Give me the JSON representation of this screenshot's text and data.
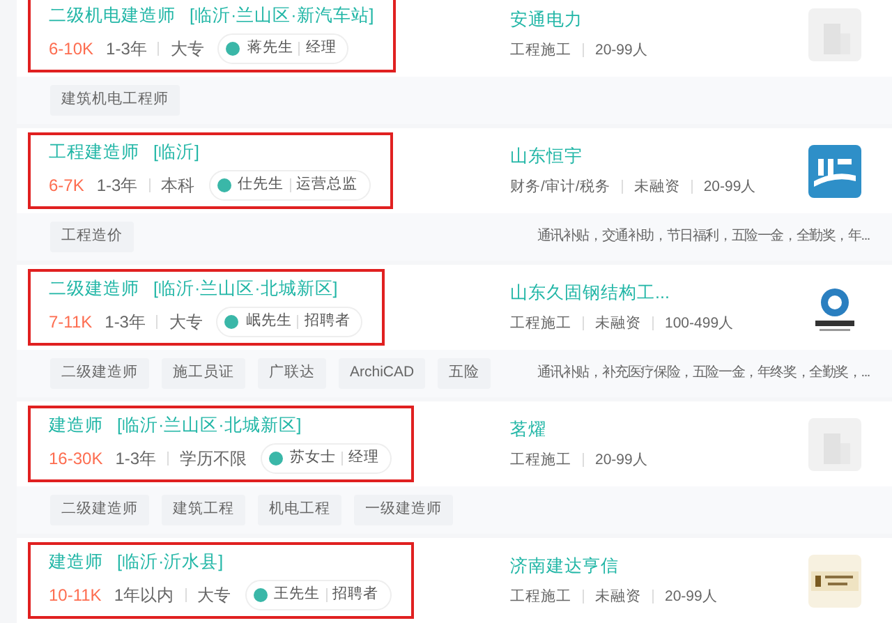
{
  "jobs": [
    {
      "title": "二级机电建造师",
      "location": "[临沂·兰山区·新汽车站]",
      "salary": "6-10K",
      "experience": "1-3年",
      "education": "大专",
      "recruiter": {
        "name": "蒋先生",
        "role": "经理"
      },
      "highlighted": true,
      "company": {
        "name": "安通电力",
        "details": [
          "工程施工",
          "20-99人"
        ],
        "logo": {
          "kind": "placeholder"
        }
      },
      "tags": [
        "建筑机电工程师"
      ]
    },
    {
      "title": "工程建造师",
      "location": "[临沂]",
      "salary": "6-7K",
      "experience": "1-3年",
      "education": "本科",
      "recruiter": {
        "name": "仕先生",
        "role": "运营总监"
      },
      "highlighted": true,
      "company": {
        "name": "山东恒宇",
        "details": [
          "财务/审计/税务",
          "未融资",
          "20-99人"
        ],
        "logo": {
          "kind": "picture"
        }
      },
      "tags": [
        "工程造价"
      ],
      "benefits": "通讯补贴，交通补助，节日福利，五险一金，全勤奖，年..."
    },
    {
      "title": "二级建造师",
      "location": "[临沂·兰山区·北城新区]",
      "salary": "7-11K",
      "experience": "1-3年",
      "education": "大专",
      "recruiter": {
        "name": "岷先生",
        "role": "招聘者"
      },
      "highlighted": true,
      "company": {
        "name": "山东久固钢结构工...",
        "details": [
          "工程施工",
          "未融资",
          "100-499人"
        ],
        "logo": {
          "kind": "picture"
        }
      },
      "tags": [
        "二级建造师",
        "施工员证",
        "广联达",
        "ArchiCAD",
        "五险"
      ],
      "benefits": "通讯补贴，补充医疗保险，五险一金，年终奖，全勤奖，..."
    },
    {
      "title": "建造师",
      "location": "[临沂·兰山区·北城新区]",
      "salary": "16-30K",
      "experience": "1-3年",
      "education": "学历不限",
      "recruiter": {
        "name": "苏女士",
        "role": "经理"
      },
      "highlighted": true,
      "company": {
        "name": "茗燿",
        "details": [
          "工程施工",
          "20-99人"
        ],
        "logo": {
          "kind": "placeholder"
        }
      },
      "tags": [
        "二级建造师",
        "建筑工程",
        "机电工程",
        "一级建造师"
      ]
    },
    {
      "title": "建造师",
      "location": "[临沂·沂水县]",
      "salary": "10-11K",
      "experience": "1年以内",
      "education": "大专",
      "recruiter": {
        "name": "王先生",
        "role": "招聘者"
      },
      "highlighted": true,
      "company": {
        "name": "济南建达亨信",
        "details": [
          "工程施工",
          "未融资",
          "20-99人"
        ],
        "logo": {
          "kind": "picture"
        }
      }
    }
  ]
}
